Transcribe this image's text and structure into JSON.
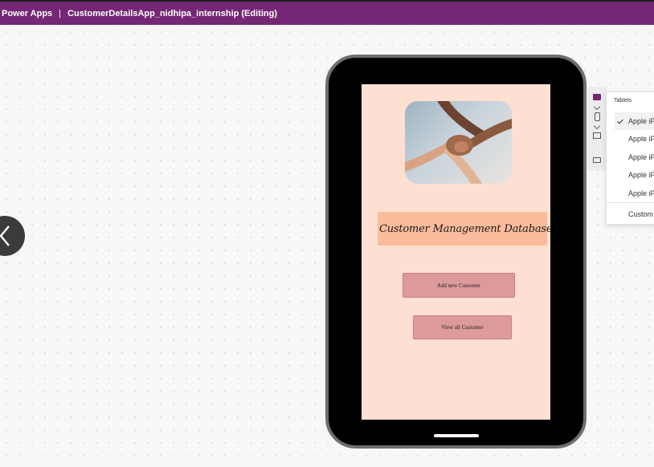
{
  "app": {
    "product": "Power Apps",
    "separator": "|",
    "document_title": "CustomerDetailsApp_nidhipa_internship (Editing)"
  },
  "colors": {
    "brand": "#742774",
    "screen_bg": "#fde0d2",
    "title_band": "#fbbc9d",
    "button_bg": "#dc9a9a"
  },
  "canvas_app": {
    "title": "Customer Management Database",
    "add_button_label": "Add new Customer",
    "view_button_label": "View all Customer",
    "hero_image": "hands-holding-wrists"
  },
  "device_picker": {
    "header": "Tablets",
    "items": [
      {
        "label": "Apple iP",
        "selected": true
      },
      {
        "label": "Apple iP",
        "selected": false
      },
      {
        "label": "Apple iP",
        "selected": false
      },
      {
        "label": "Apple iP",
        "selected": false
      },
      {
        "label": "Apple iP",
        "selected": false
      }
    ],
    "custom_label": "Custom"
  },
  "icons": {
    "back": "chevron-left-icon",
    "tablet": "tablet-icon",
    "phone": "phone-icon",
    "desktop": "desktop-icon",
    "custom": "custom-size-icon"
  }
}
